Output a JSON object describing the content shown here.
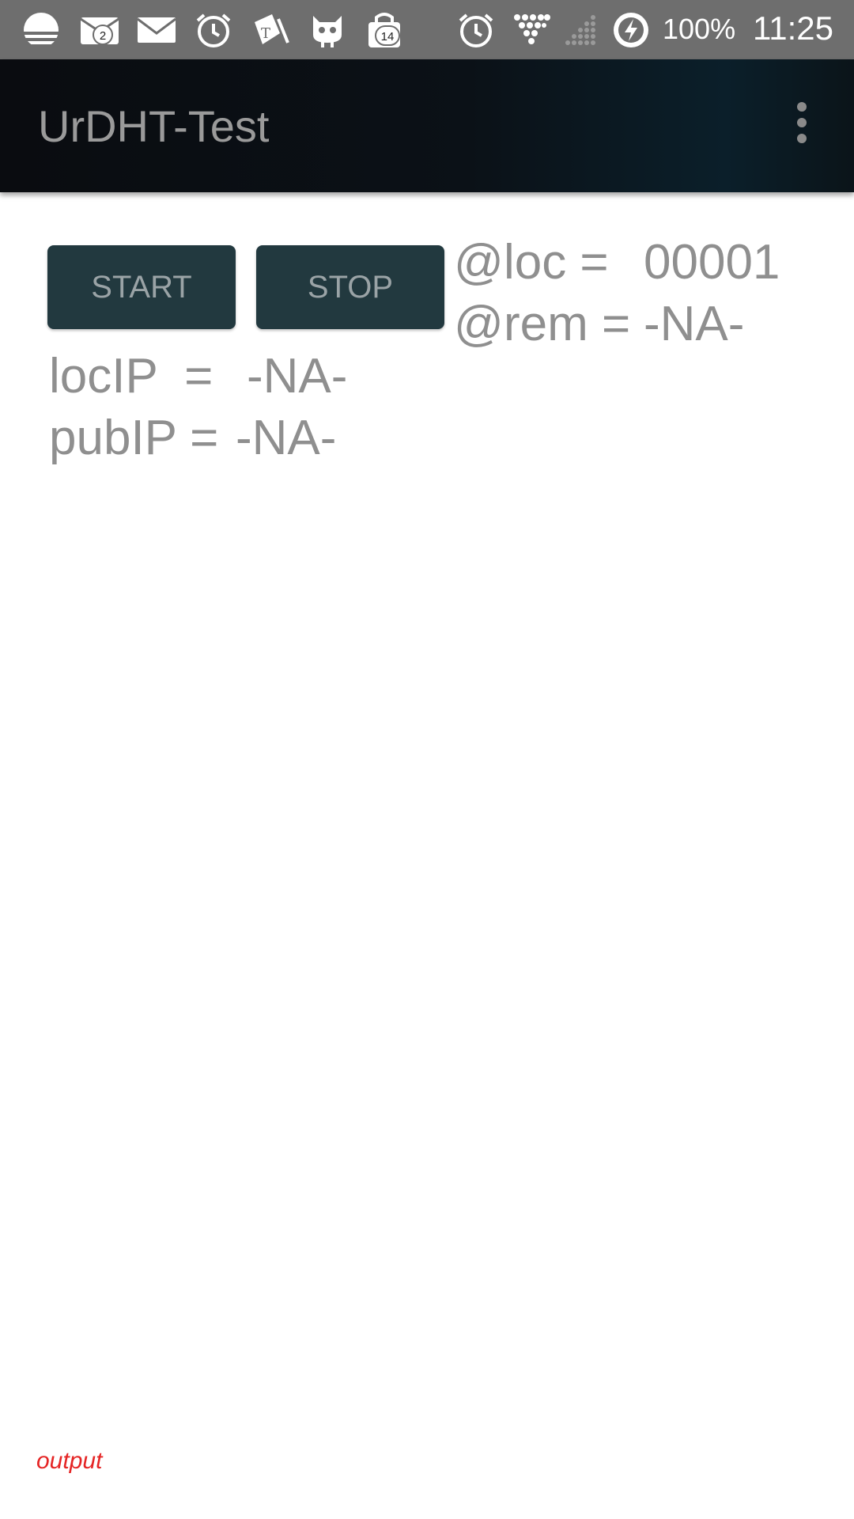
{
  "status_bar": {
    "notifications": [
      {
        "icon": "weather-icon"
      },
      {
        "icon": "mail-icon",
        "badge": "2"
      },
      {
        "icon": "envelope-icon"
      },
      {
        "icon": "alarm-clock-icon"
      },
      {
        "icon": "telekom-tag-icon"
      },
      {
        "icon": "cyanogen-mascot-icon"
      },
      {
        "icon": "shopping-bag-icon",
        "badge": "14"
      }
    ],
    "system_icons": [
      "alarm-clock-icon",
      "wifi-icon",
      "cell-signal-icon",
      "battery-charging-icon"
    ],
    "battery": "100%",
    "time": "11:25",
    "color": "#6e6e6e"
  },
  "app_bar": {
    "title": "UrDHT-Test",
    "overflow_icon": "more-vert-icon"
  },
  "controls": {
    "start_label": "START",
    "stop_label": "STOP",
    "button_color": "#22393f"
  },
  "readouts": {
    "loc_label": "@loc =",
    "loc_value": "00001",
    "rem_label": "@rem =",
    "rem_value": "-NA-",
    "locip_label": "locIP  =",
    "locip_value": "-NA-",
    "pubip_label": "pubIP =",
    "pubip_value": "-NA-"
  },
  "footer": {
    "output_label": "output",
    "output_color": "#e52424"
  }
}
